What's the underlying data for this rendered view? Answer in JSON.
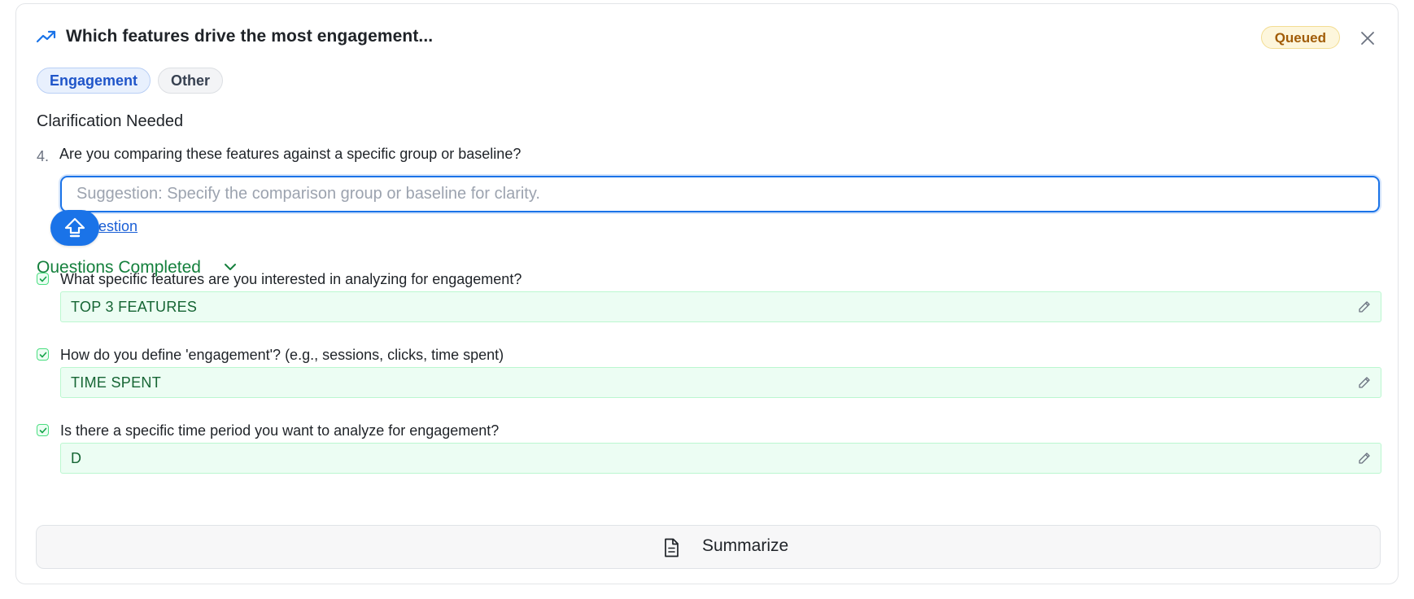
{
  "header": {
    "title": "Which features drive the most engagement...",
    "status": "Queued",
    "icons": {
      "trend": "trending-up-icon",
      "close": "close-icon"
    }
  },
  "tags": [
    "Engagement",
    "Other"
  ],
  "clarification": {
    "heading": "Clarification Needed",
    "question_number": "4.",
    "question": "Are you comparing these features against a specific group or baseline?",
    "input_value": "",
    "input_placeholder": "Suggestion: Specify the comparison group or baseline for clarity.",
    "suggestion_link": "Use suggestion",
    "suggestion_link_visible": "suggestion"
  },
  "completed": {
    "label": "Questions Completed",
    "items": [
      {
        "question": "What specific features are you interested in analyzing for engagement?",
        "answer": "TOP 3 FEATURES"
      },
      {
        "question": "How do you define 'engagement'? (e.g., sessions, clicks, time spent)",
        "answer": "TIME SPENT"
      },
      {
        "question": "Is there a specific time period you want to analyze for engagement?",
        "answer": "D"
      }
    ]
  },
  "summarize": {
    "label": "Summarize",
    "icon": "document-icon"
  },
  "colors": {
    "accent": "#1a73e8",
    "success": "#15803d",
    "success_bg": "#ecfdf3",
    "queued_bg": "#fdf6dc",
    "queued_text": "#a15c07"
  }
}
